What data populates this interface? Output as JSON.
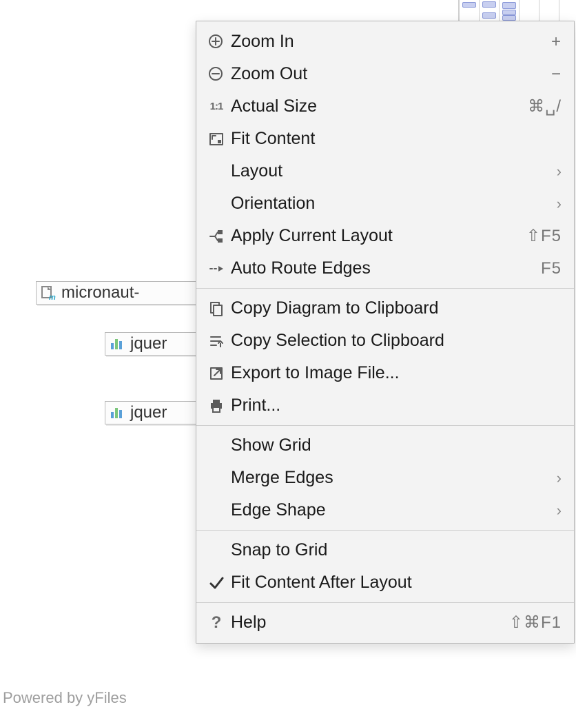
{
  "canvas": {
    "nodes": [
      {
        "label": "micronaut-",
        "icon": "module"
      },
      {
        "label": "jquer",
        "icon": "bars"
      },
      {
        "label": "jquer",
        "icon": "bars"
      }
    ]
  },
  "powered_by": "Powered by yFiles",
  "menu": {
    "groups": [
      [
        {
          "icon": "zoom-in",
          "label": "Zoom In",
          "shortcut": "+"
        },
        {
          "icon": "zoom-out",
          "label": "Zoom Out",
          "shortcut": "−"
        },
        {
          "icon": "one-to-one",
          "label": "Actual Size",
          "shortcut": "⌘␣/"
        },
        {
          "icon": "fit",
          "label": "Fit Content",
          "shortcut": ""
        },
        {
          "icon": "",
          "label": "Layout",
          "submenu": true
        },
        {
          "icon": "",
          "label": "Orientation",
          "submenu": true
        },
        {
          "icon": "layout",
          "label": "Apply Current Layout",
          "shortcut": "⇧F5"
        },
        {
          "icon": "route",
          "label": "Auto Route Edges",
          "shortcut": "F5"
        }
      ],
      [
        {
          "icon": "copy",
          "label": "Copy Diagram to Clipboard"
        },
        {
          "icon": "copy-sel",
          "label": "Copy Selection to Clipboard"
        },
        {
          "icon": "export",
          "label": "Export to Image File..."
        },
        {
          "icon": "print",
          "label": "Print..."
        }
      ],
      [
        {
          "icon": "",
          "label": "Show Grid"
        },
        {
          "icon": "",
          "label": "Merge Edges",
          "submenu": true
        },
        {
          "icon": "",
          "label": "Edge Shape",
          "submenu": true
        }
      ],
      [
        {
          "icon": "",
          "label": "Snap to Grid"
        },
        {
          "icon": "check",
          "label": "Fit Content After Layout"
        }
      ],
      [
        {
          "icon": "help",
          "label": "Help",
          "shortcut": "⇧⌘F1"
        }
      ]
    ]
  }
}
